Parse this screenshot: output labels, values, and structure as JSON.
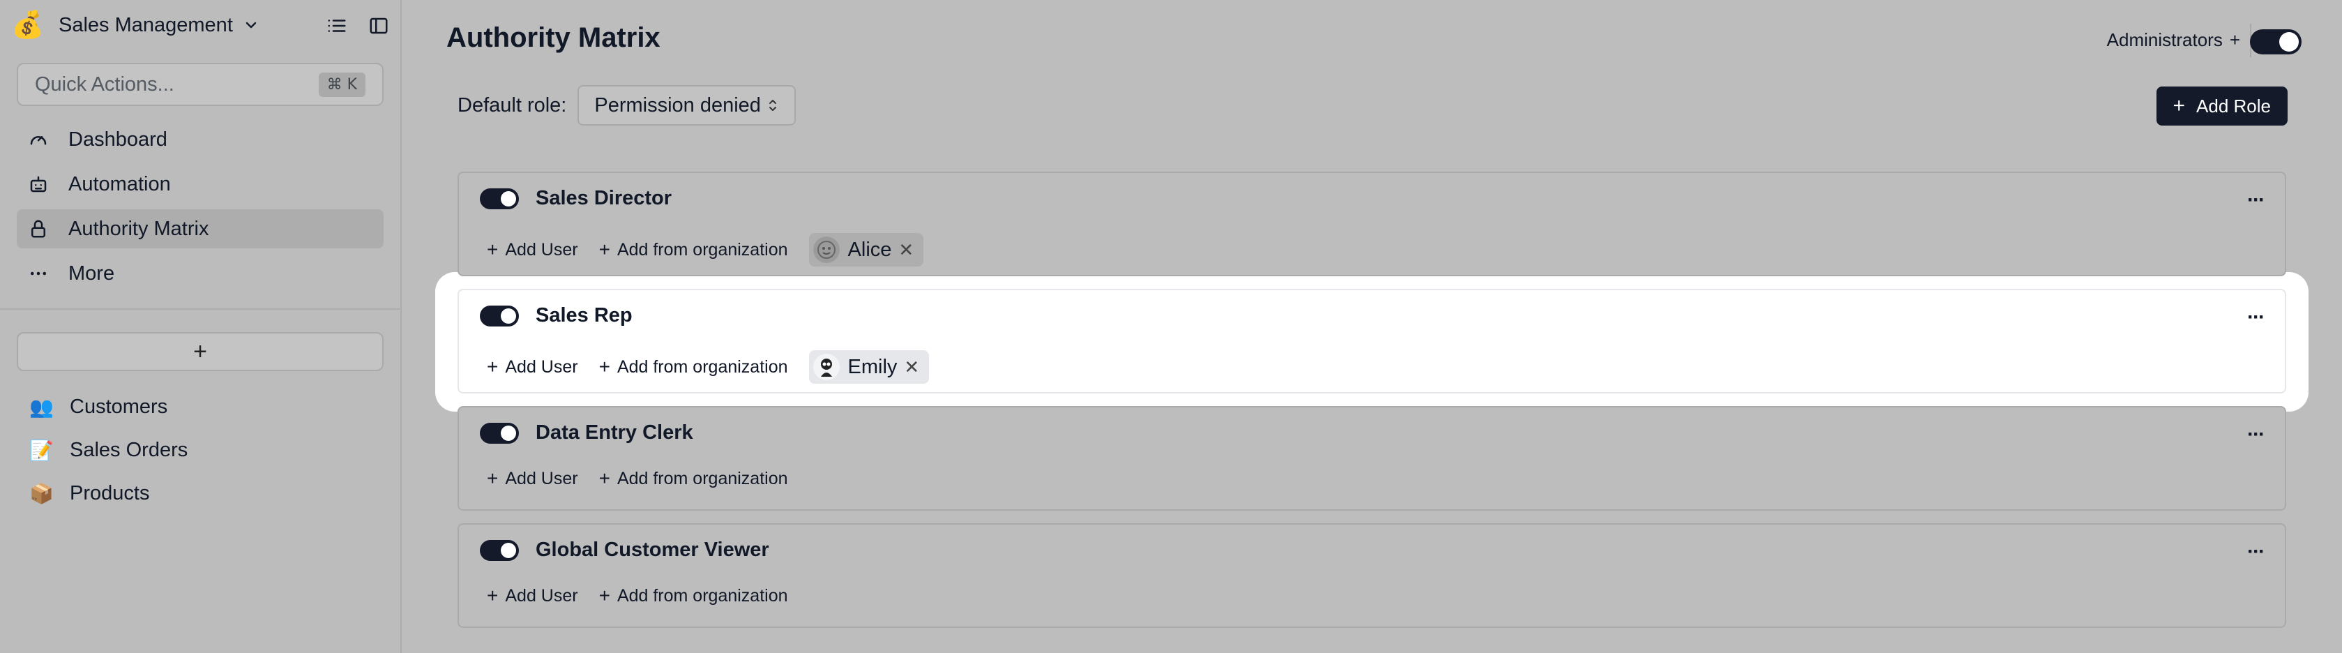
{
  "sidebar": {
    "app_name": "Sales Management",
    "app_logo": "💰",
    "quick_actions_placeholder": "Quick Actions...",
    "quick_actions_shortcut": "⌘ K",
    "nav": [
      {
        "label": "Dashboard",
        "icon": "gauge-icon"
      },
      {
        "label": "Automation",
        "icon": "robot-icon"
      },
      {
        "label": "Authority Matrix",
        "icon": "lock-icon",
        "active": true
      },
      {
        "label": "More",
        "icon": "more-horizontal-icon"
      }
    ],
    "add_label": "+",
    "tables": [
      {
        "emoji": "👥",
        "label": "Customers"
      },
      {
        "emoji": "📝",
        "label": "Sales Orders"
      },
      {
        "emoji": "📦",
        "label": "Products"
      }
    ]
  },
  "main": {
    "title": "Authority Matrix",
    "administrators_label": "Administrators",
    "administrators_plus": "+",
    "default_role_label": "Default role:",
    "default_role_value": "Permission denied",
    "add_role_label": "Add Role",
    "add_user_label": "Add User",
    "add_from_org_label": "Add from organization",
    "more_label": "···",
    "roles": [
      {
        "name": "Sales Director",
        "enabled": true,
        "users": [
          {
            "name": "Alice"
          }
        ],
        "highlighted": false
      },
      {
        "name": "Sales Rep",
        "enabled": true,
        "users": [
          {
            "name": "Emily"
          }
        ],
        "highlighted": true
      },
      {
        "name": "Data Entry Clerk",
        "enabled": true,
        "users": [],
        "highlighted": false
      },
      {
        "name": "Global Customer Viewer",
        "enabled": true,
        "users": [],
        "highlighted": false
      }
    ]
  },
  "colors": {
    "accent_dark": "#141a2a",
    "dim_background": "#bdbdbd",
    "highlight": "#ffffff"
  }
}
